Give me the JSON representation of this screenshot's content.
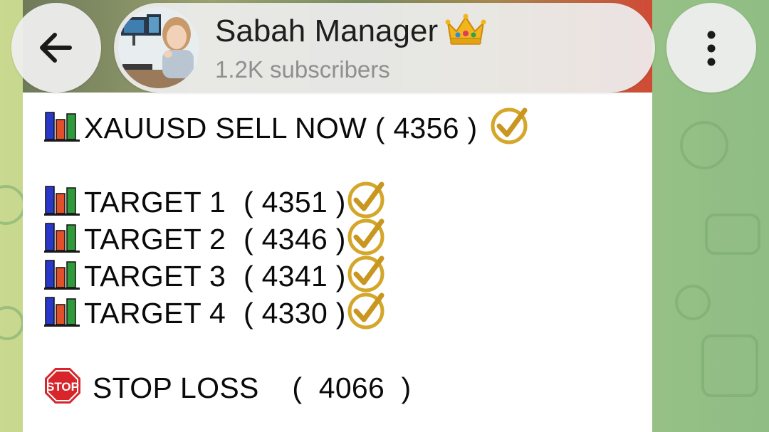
{
  "header": {
    "back_icon": "arrow-left-icon",
    "channel_name": "Sabah Manager",
    "crown_icon": "crown-emoji",
    "subscribers": "1.2K subscribers",
    "menu_icon": "more-vertical-icon"
  },
  "message": {
    "signal": {
      "icon": "bar-chart-emoji",
      "text": "XAUUSD SELL NOW ( 4356 )",
      "check_icon": "check-mark-emoji"
    },
    "targets": [
      {
        "label": "TARGET 1",
        "value": "( 4351 )"
      },
      {
        "label": "TARGET 2",
        "value": "( 4346 )"
      },
      {
        "label": "TARGET 3",
        "value": "( 4341 )"
      },
      {
        "label": "TARGET 4",
        "value": "( 4330 )"
      }
    ],
    "stop_loss": {
      "icon": "stop-sign-emoji",
      "text": "STOP LOSS    (  4066  )"
    }
  },
  "colors": {
    "wallpaper_left": "#c9d98f",
    "wallpaper_right": "#8fbd84",
    "bubble": "#ffffff",
    "text": "#0a0a0a",
    "subtitle": "#8f8f8f",
    "check_gold": "#d4a62a",
    "stop_red": "#d7262b"
  }
}
